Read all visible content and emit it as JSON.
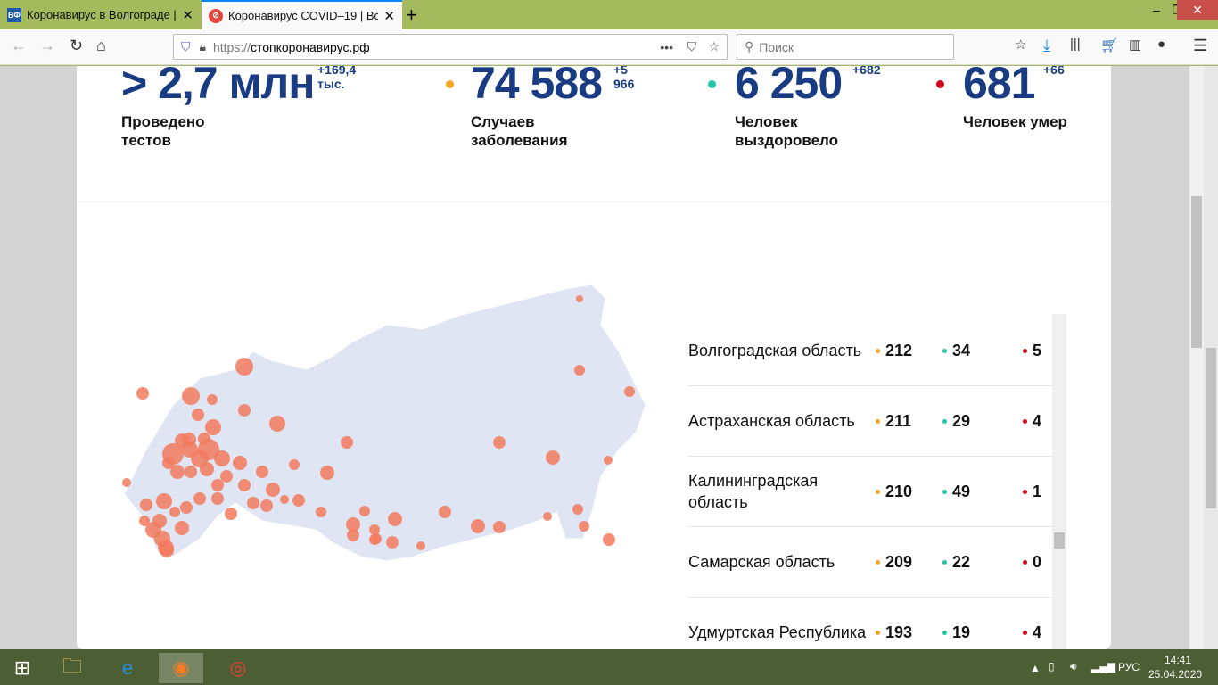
{
  "browser": {
    "tabs": [
      {
        "label": "Коронавирус в Волгограде | С",
        "favicon": "ВФ"
      },
      {
        "label": "Коронавирус COVID–19 | Все ч",
        "favicon": "covid-icon"
      }
    ],
    "url_prefix": "https://",
    "url_host": "стопкоронавирус.рф",
    "search_placeholder": "Поиск"
  },
  "stats": [
    {
      "value": "> 2,7 млн",
      "delta": "+169,4 тыс.",
      "label": "Проведено тестов",
      "color": ""
    },
    {
      "value": "74 588",
      "delta": "+5 966",
      "label": "Случаев заболевания",
      "color": "#f5a623"
    },
    {
      "value": "6 250",
      "delta": "+682",
      "label": "Человек выздоровело",
      "color": "#1ec8a5"
    },
    {
      "value": "681",
      "delta": "+66",
      "label": "Человек умер",
      "color": "#d0021b"
    }
  ],
  "regions": [
    {
      "name": "Волгоградская область",
      "cases": "212",
      "recovered": "34",
      "deaths": "5"
    },
    {
      "name": "Астраханская область",
      "cases": "211",
      "recovered": "29",
      "deaths": "4"
    },
    {
      "name": "Калининградская область",
      "cases": "210",
      "recovered": "49",
      "deaths": "1"
    },
    {
      "name": "Самарская область",
      "cases": "209",
      "recovered": "22",
      "deaths": "0"
    },
    {
      "name": "Удмуртская Республика",
      "cases": "193",
      "recovered": "19",
      "deaths": "4"
    }
  ],
  "taskbar": {
    "lang": "РУС",
    "time": "14:41",
    "date": "25.04.2020"
  }
}
